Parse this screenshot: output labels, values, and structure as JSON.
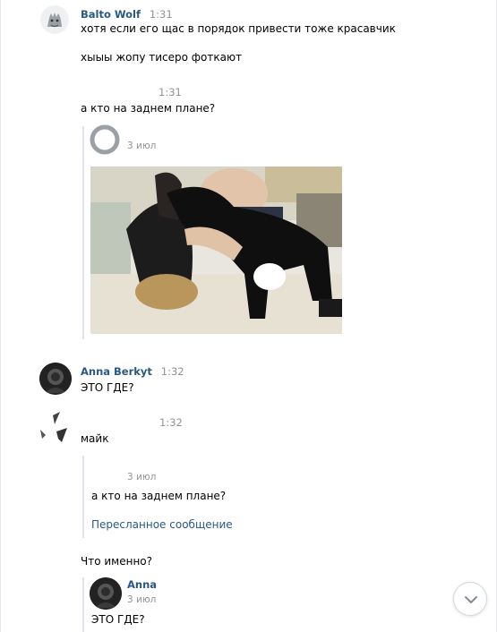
{
  "messages": [
    {
      "author": "Balto Wolf",
      "time": "1:31",
      "lines": [
        "хотя если его щас в порядок привести тоже красавчик",
        "хыыы жопу тисеро фоткают"
      ]
    },
    {
      "time": "1:31",
      "text": "а кто на заднем плане?",
      "forward": {
        "date": "3 июл",
        "photo_icon": "photo-image"
      }
    },
    {
      "author": "Anna Berkyt",
      "time": "1:32",
      "text": "ЭТО ГДЕ?"
    },
    {
      "time": "1:32",
      "text": "майк",
      "forward": {
        "date": "3 июл",
        "text": "а кто на заднем плане?",
        "link": "Пересланное сообщение"
      }
    },
    {
      "text": "Что именно?",
      "forward": {
        "author": "Anna",
        "date": "3 июл",
        "text": "ЭТО ГДЕ?"
      }
    }
  ],
  "ui": {
    "scroll_down_icon": "chevron-down-icon",
    "accent": "#2a5885",
    "muted": "#939393"
  }
}
